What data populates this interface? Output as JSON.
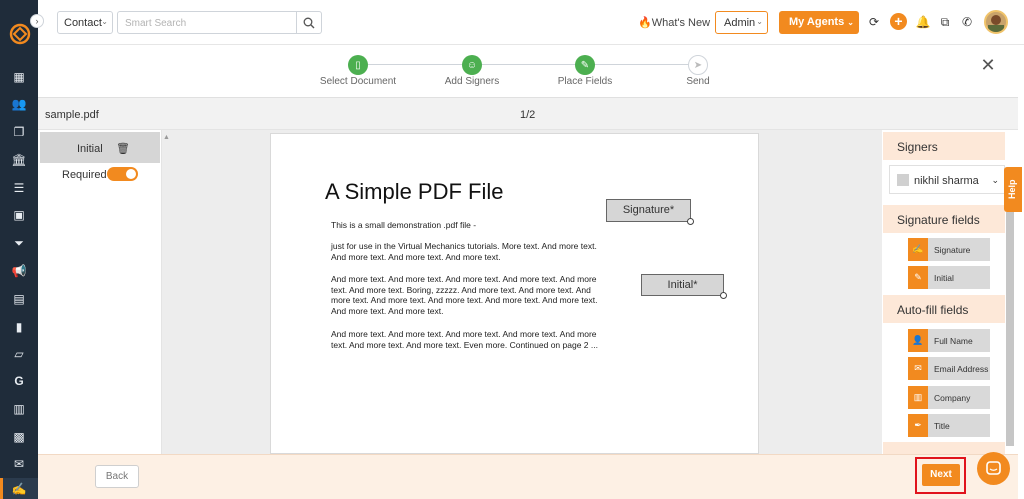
{
  "topbar": {
    "contact_label": "Contact",
    "search_placeholder": "Smart Search",
    "whats_new_label": "What's New",
    "admin_label": "Admin",
    "my_agents_label": "My Agents"
  },
  "stepper": {
    "steps": [
      {
        "label": "Select Document",
        "status": "done"
      },
      {
        "label": "Add Signers",
        "status": "done"
      },
      {
        "label": "Place Fields",
        "status": "done"
      },
      {
        "label": "Send",
        "status": "pending"
      }
    ]
  },
  "filebar": {
    "filename": "sample.pdf",
    "page_indicator": "1/2"
  },
  "widget_panel": {
    "selected_widget": "Initial",
    "required_label": "Required",
    "required_on": true
  },
  "document": {
    "title": "A Simple PDF File",
    "paragraphs": [
      "This is a small demonstration .pdf file -",
      "just for use in the Virtual Mechanics tutorials. More text. And more text. And more text. And more text. And more text.",
      "And more text. And more text. And more text. And more text. And more text. And more text. Boring, zzzzz. And more text. And more text. And more text. And more text. And more text. And more text. And more text. And more text. And more text.",
      "And more text. And more text. And more text. And more text. And more text. And more text. And more text. Even more. Continued on page 2 ..."
    ],
    "signature_field": "Signature*",
    "initial_field": "Initial*"
  },
  "right_panel": {
    "signers_title": "Signers",
    "signer_name": "nikhil sharma",
    "signature_fields_title": "Signature fields",
    "signature_fields": [
      "Signature",
      "Initial"
    ],
    "autofill_title": "Auto-fill fields",
    "autofill_fields": [
      "Full Name",
      "Email Address",
      "Company",
      "Title"
    ],
    "help_label": "Help"
  },
  "footer": {
    "back_label": "Back",
    "next_label": "Next"
  },
  "colors": {
    "accent": "#f28a1f",
    "nav_bg": "#1f2c3a",
    "step_done": "#4caf50",
    "highlight_outline": "#e0131c"
  }
}
